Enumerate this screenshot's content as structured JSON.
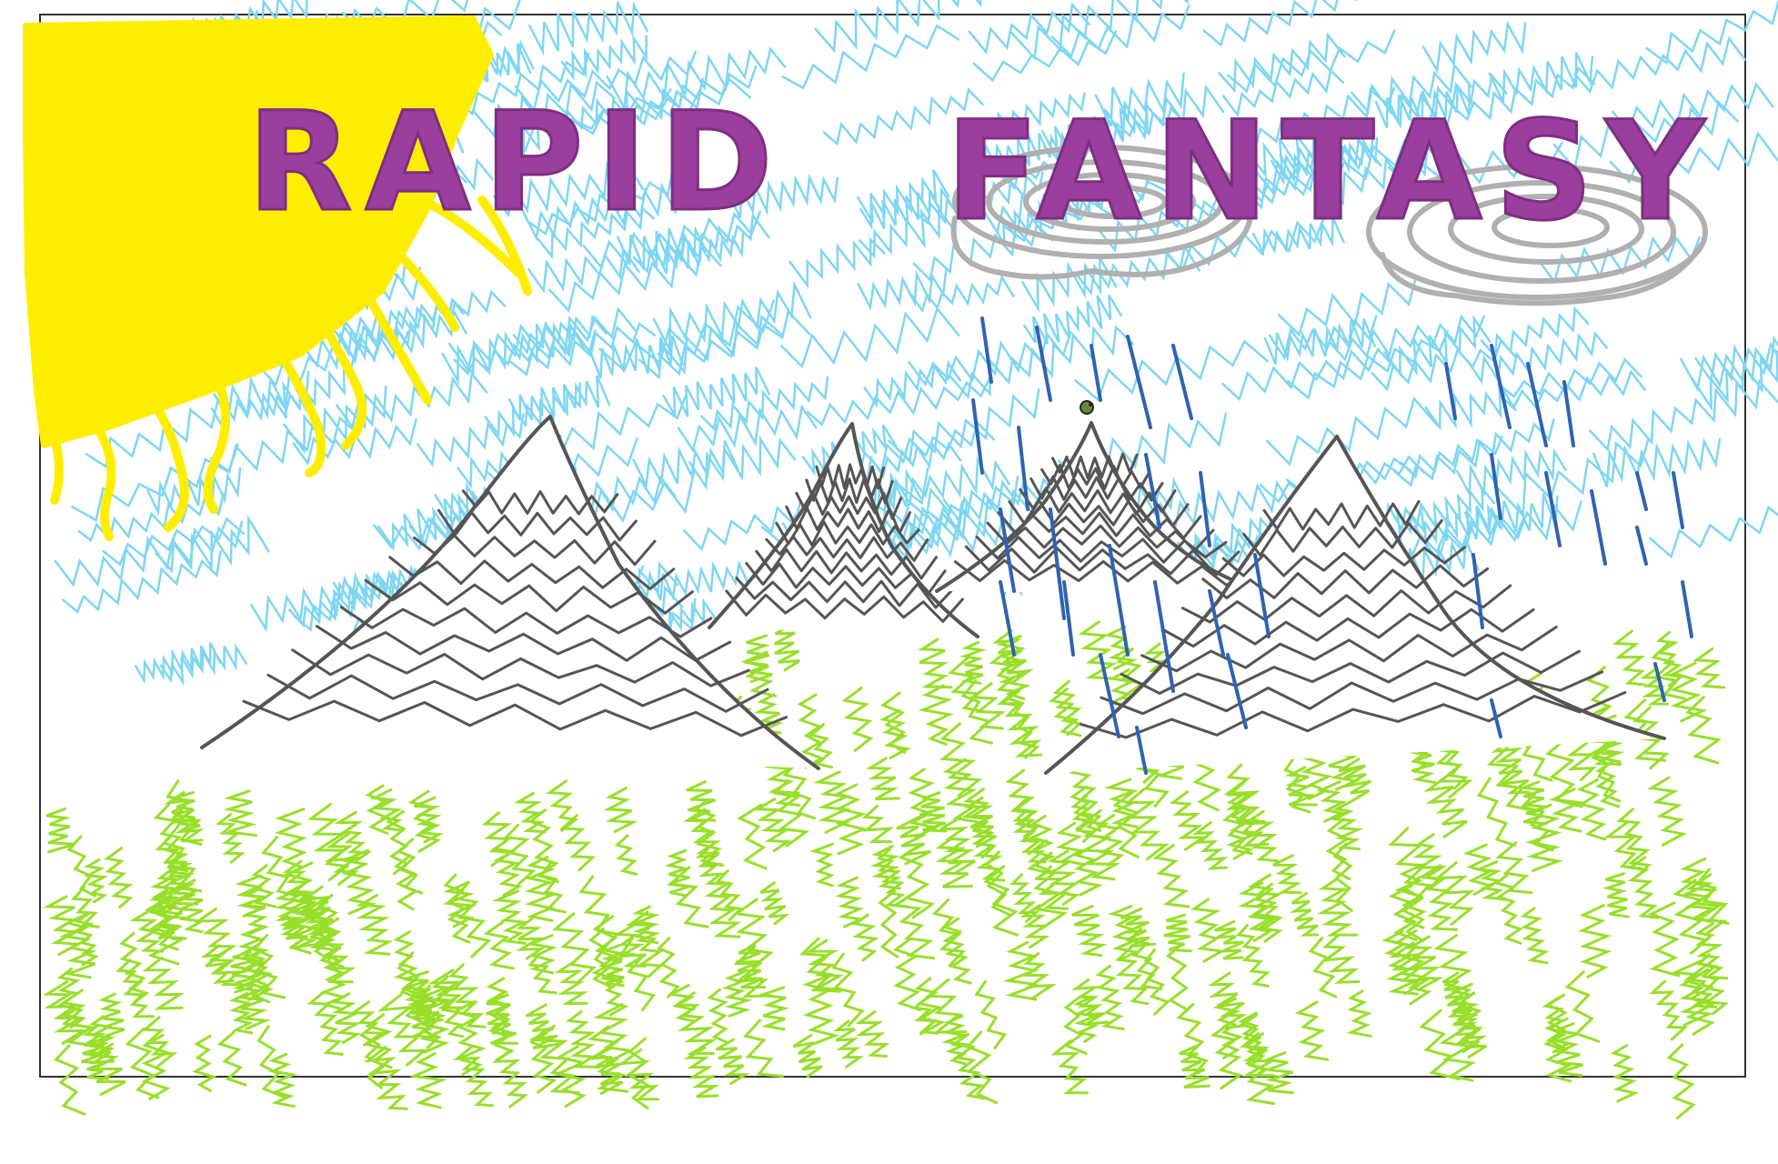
{
  "title": {
    "word1": "RAPID",
    "word2": "FANTASY"
  },
  "colors": {
    "sky": "#7fd6f2",
    "sun": "#ffee00",
    "title": "#9b3f9e",
    "grass": "#98df2a",
    "mountain_outline": "#555555",
    "cloud": "#b0b0b0",
    "rain": "#2f63b0",
    "frame": "#333333",
    "background": "#ffffff"
  },
  "scene": {
    "elements": [
      "sun-icon",
      "sky",
      "cloud-icon",
      "cloud-icon",
      "rain",
      "mountain-icon",
      "mountain-icon",
      "mountain-icon",
      "mountain-icon",
      "grass",
      "bird-icon"
    ]
  }
}
